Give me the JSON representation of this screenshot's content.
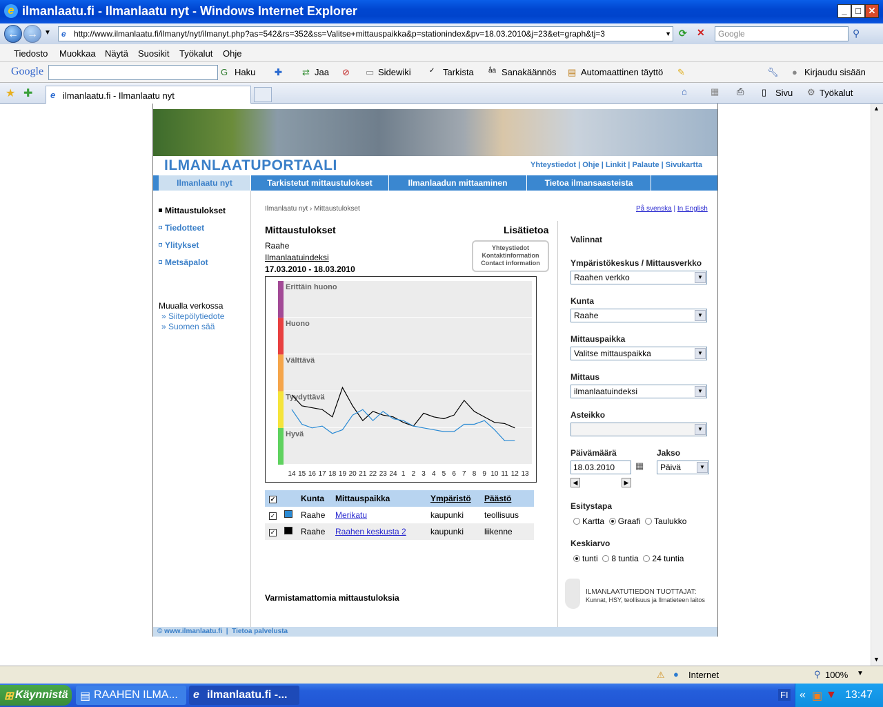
{
  "window": {
    "title": "ilmanlaatu.fi - Ilmanlaatu nyt - Windows Internet Explorer"
  },
  "address": {
    "url": "http://www.ilmanlaatu.fi/ilmanyt/nyt/ilmanyt.php?as=542&rs=352&ss=Valitse+mittauspaikka&p=stationindex&pv=18.03.2010&j=23&et=graph&tj=3",
    "search_placeholder": "Google"
  },
  "menu": [
    "Tiedosto",
    "Muokkaa",
    "Näytä",
    "Suosikit",
    "Työkalut",
    "Ohje"
  ],
  "google_toolbar": {
    "logo": "Google",
    "items": [
      "Haku",
      "Jaa",
      "Sidewiki",
      "Tarkista",
      "Sanakäännös",
      "Automaattinen täyttö",
      "Kirjaudu sisään"
    ]
  },
  "tabs": {
    "current": "ilmanlaatu.fi - Ilmanlaatu nyt",
    "tools": [
      "Sivu",
      "Työkalut"
    ]
  },
  "site": {
    "logo": "ILMANLAATUPORTAALI",
    "toplinks": [
      "Yhteystiedot",
      "Ohje",
      "Linkit",
      "Palaute",
      "Sivukartta"
    ],
    "nav": [
      "Ilmanlaatu nyt",
      "Tarkistetut mittaustulokset",
      "Ilmanlaadun mittaaminen",
      "Tietoa ilmansaasteista"
    ],
    "left_links": [
      "Mittaustulokset",
      "Tiedotteet",
      "Ylitykset",
      "Metsäpalot"
    ],
    "elsewhere_title": "Muualla verkossa",
    "elsewhere_links": [
      "Siitepölytiedote",
      "Suomen sää"
    ],
    "breadcrumb": "Ilmanlaatu nyt › Mittaustulokset",
    "lang_links": [
      "På svenska",
      "In English"
    ],
    "main_title": "Mittaustulokset",
    "lisatietoa": "Lisätietoa",
    "location": "Raahe",
    "index_link": "Ilmanlaatuindeksi",
    "daterange": "17.03.2010 - 18.03.2010",
    "contact_box": [
      "Yhteystiedot",
      "Kontaktinformation",
      "Contact information"
    ],
    "unconfirmed": "Varmistamattomia mittaustuloksia",
    "footer": [
      "© www.ilmanlaatu.fi",
      "Tietoa palvelusta"
    ],
    "producers_title": "ILMANLAATUTIEDON TUOTTAJAT:",
    "producers_text": "Kunnat, HSY, teollisuus ja Ilmatieteen laitos"
  },
  "table": {
    "headers": [
      "Kunta",
      "Mittauspaikka",
      "Ympäristö",
      "Päästö"
    ],
    "rows": [
      {
        "kunta": "Raahe",
        "paikka": "Merikatu",
        "ymparisto": "kaupunki",
        "paasto": "teollisuus",
        "color": "#2a8ad4"
      },
      {
        "kunta": "Raahe",
        "paikka": "Raahen keskusta 2",
        "ymparisto": "kaupunki",
        "paasto": "liikenne",
        "color": "#000000"
      }
    ]
  },
  "form": {
    "valinnat": "Valinnat",
    "verkko_label": "Ympäristökeskus / Mittausverkko",
    "verkko": "Raahen verkko",
    "kunta_label": "Kunta",
    "kunta": "Raahe",
    "paikka_label": "Mittauspaikka",
    "paikka": "Valitse mittauspaikka",
    "mittaus_label": "Mittaus",
    "mittaus": "ilmanlaatuindeksi",
    "asteikko_label": "Asteikko",
    "asteikko": "",
    "paiva_label": "Päivämäärä",
    "paiva": "18.03.2010",
    "jakso_label": "Jakso",
    "jakso": "Päivä",
    "esitys_label": "Esitystapa",
    "esitys": [
      "Kartta",
      "Graafi",
      "Taulukko"
    ],
    "keski_label": "Keskiarvo",
    "keski": [
      "tunti",
      "8 tuntia",
      "24 tuntia"
    ]
  },
  "status": {
    "zone": "Internet",
    "zoom": "100%"
  },
  "taskbar": {
    "start": "Käynnistä",
    "tasks": [
      "RAAHEN ILMA...",
      "ilmanlaatu.fi -..."
    ],
    "lang": "FI",
    "time": "13:47"
  },
  "chart_data": {
    "type": "line",
    "x": [
      "14",
      "15",
      "16",
      "17",
      "18",
      "19",
      "20",
      "21",
      "22",
      "23",
      "24",
      "1",
      "2",
      "3",
      "4",
      "5",
      "6",
      "7",
      "8",
      "9",
      "10",
      "11",
      "12",
      "13"
    ],
    "bands": [
      {
        "label": "Hyvä",
        "color": "#5fd25f"
      },
      {
        "label": "Tyydyttävä",
        "color": "#f5e43a"
      },
      {
        "label": "Välttävä",
        "color": "#f5a54a"
      },
      {
        "label": "Huono",
        "color": "#e84040"
      },
      {
        "label": "Erittäin huono",
        "color": "#a24a96"
      }
    ],
    "ylim": [
      0,
      5
    ],
    "series": [
      {
        "name": "Raahen keskusta 2",
        "color": "#000000",
        "values": [
          1.9,
          1.6,
          1.55,
          1.5,
          1.3,
          2.1,
          1.6,
          1.2,
          1.45,
          1.35,
          1.3,
          1.15,
          1.05,
          1.4,
          1.3,
          1.25,
          1.35,
          1.75,
          1.45,
          1.3,
          1.15,
          1.12,
          1.0
        ]
      },
      {
        "name": "Merikatu",
        "color": "#2a8ad4",
        "values": [
          1.5,
          1.1,
          1.0,
          1.05,
          0.85,
          0.95,
          1.35,
          1.5,
          1.2,
          1.45,
          1.25,
          1.2,
          1.05,
          1.0,
          0.95,
          0.9,
          0.9,
          1.1,
          1.1,
          1.2,
          0.95,
          0.65,
          0.65
        ]
      }
    ]
  }
}
